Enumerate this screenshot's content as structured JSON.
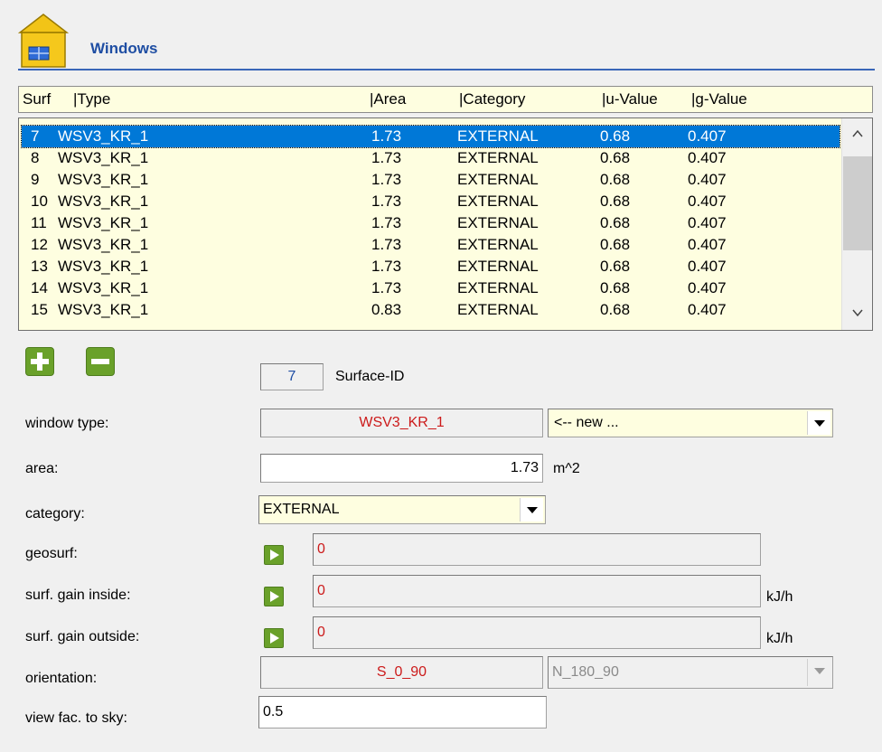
{
  "header": {
    "title": "Windows",
    "icon": "house-window-icon"
  },
  "table": {
    "columns": [
      "Surf",
      "|Type",
      "|Area",
      "|Category",
      "|u-Value",
      "|g-Value"
    ],
    "rows": [
      {
        "surf": "7",
        "type": "WSV3_KR_1",
        "area": "1.73",
        "category": "EXTERNAL",
        "u": "0.68",
        "g": "0.407"
      },
      {
        "surf": "8",
        "type": "WSV3_KR_1",
        "area": "1.73",
        "category": "EXTERNAL",
        "u": "0.68",
        "g": "0.407"
      },
      {
        "surf": "9",
        "type": "WSV3_KR_1",
        "area": "1.73",
        "category": "EXTERNAL",
        "u": "0.68",
        "g": "0.407"
      },
      {
        "surf": "10",
        "type": "WSV3_KR_1",
        "area": "1.73",
        "category": "EXTERNAL",
        "u": "0.68",
        "g": "0.407"
      },
      {
        "surf": "11",
        "type": "WSV3_KR_1",
        "area": "1.73",
        "category": "EXTERNAL",
        "u": "0.68",
        "g": "0.407"
      },
      {
        "surf": "12",
        "type": "WSV3_KR_1",
        "area": "1.73",
        "category": "EXTERNAL",
        "u": "0.68",
        "g": "0.407"
      },
      {
        "surf": "13",
        "type": "WSV3_KR_1",
        "area": "1.73",
        "category": "EXTERNAL",
        "u": "0.68",
        "g": "0.407"
      },
      {
        "surf": "14",
        "type": "WSV3_KR_1",
        "area": "1.73",
        "category": "EXTERNAL",
        "u": "0.68",
        "g": "0.407"
      },
      {
        "surf": "15",
        "type": "WSV3_KR_1",
        "area": "0.83",
        "category": "EXTERNAL",
        "u": "0.68",
        "g": "0.407"
      }
    ],
    "selected_index": 0
  },
  "form": {
    "surface_id_value": "7",
    "surface_id_label": "Surface-ID",
    "window_type_label": "window type:",
    "window_type_value": "WSV3_KR_1",
    "window_type_select": "<-- new ...",
    "area_label": "area:",
    "area_value": "1.73",
    "area_unit": "m^2",
    "category_label": "category:",
    "category_value": "EXTERNAL",
    "geosurf_label": "geosurf:",
    "geosurf_value": "0",
    "gain_inside_label": "surf. gain inside:",
    "gain_inside_value": "0",
    "gain_inside_unit": "kJ/h",
    "gain_outside_label": "surf. gain outside:",
    "gain_outside_value": "0",
    "gain_outside_unit": "kJ/h",
    "orientation_label": "orientation:",
    "orientation_value": "S_0_90",
    "orientation_select": "N_180_90",
    "view_fac_label": "view fac. to sky:",
    "view_fac_value": "0.5"
  },
  "colors": {
    "accent": "#1f4ea3",
    "selection": "#0078d7",
    "list_bg": "#fefee0",
    "button_green": "#6aa12a",
    "value_red": "#cc1a1a"
  }
}
